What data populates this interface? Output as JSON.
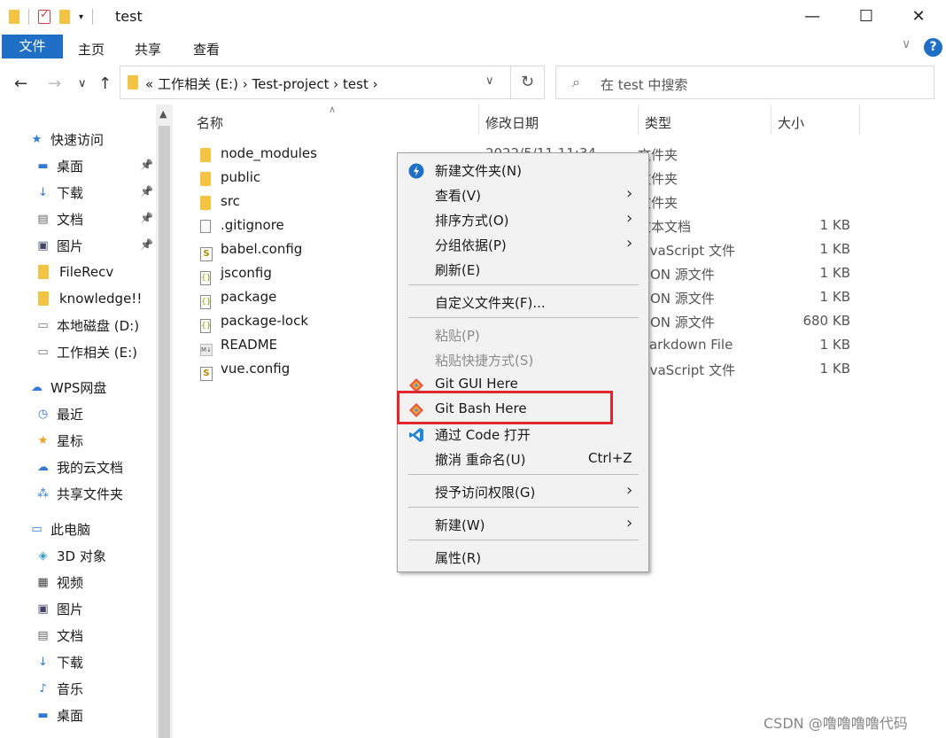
{
  "window": {
    "title": "test",
    "minimize": "—",
    "maximize": "☐",
    "close": "✕"
  },
  "ribbon": {
    "tabs": [
      "文件",
      "主页",
      "共享",
      "查看"
    ],
    "collapse": "∨",
    "help": "?"
  },
  "address": {
    "back": "←",
    "forward": "→",
    "recent": "∨",
    "up": "↑",
    "breadcrumb": "«  工作相关 (E:)  ›  Test-project  ›  test  ›",
    "dropdown": "∨",
    "refresh": "↻",
    "search_placeholder": "在 test 中搜索"
  },
  "sidebar": {
    "items": [
      {
        "label": "快速访问",
        "icon": "star-icon",
        "pinned": false
      },
      {
        "label": "桌面",
        "icon": "desktop-icon",
        "pinned": true
      },
      {
        "label": "下载",
        "icon": "download-icon",
        "pinned": true
      },
      {
        "label": "文档",
        "icon": "document-icon",
        "pinned": true
      },
      {
        "label": "图片",
        "icon": "picture-icon",
        "pinned": true
      },
      {
        "label": "FileRecv",
        "icon": "folder-icon",
        "pinned": false
      },
      {
        "label": "knowledge!!",
        "icon": "folder-icon",
        "pinned": false
      },
      {
        "label": "本地磁盘 (D:)",
        "icon": "drive-icon",
        "pinned": false
      },
      {
        "label": "工作相关 (E:)",
        "icon": "drive-icon",
        "pinned": false
      },
      {
        "label": "WPS网盘",
        "icon": "cloud-icon",
        "pinned": false
      },
      {
        "label": "最近",
        "icon": "clock-icon",
        "pinned": false
      },
      {
        "label": "星标",
        "icon": "star-icon",
        "pinned": false
      },
      {
        "label": "我的云文档",
        "icon": "cloud-icon",
        "pinned": false
      },
      {
        "label": "共享文件夹",
        "icon": "share-icon",
        "pinned": false
      },
      {
        "label": "此电脑",
        "icon": "computer-icon",
        "pinned": false
      },
      {
        "label": "3D 对象",
        "icon": "cube-icon",
        "pinned": false
      },
      {
        "label": "视频",
        "icon": "video-icon",
        "pinned": false
      },
      {
        "label": "图片",
        "icon": "picture-icon",
        "pinned": false
      },
      {
        "label": "文档",
        "icon": "document-icon",
        "pinned": false
      },
      {
        "label": "下载",
        "icon": "download-icon",
        "pinned": false
      },
      {
        "label": "音乐",
        "icon": "music-icon",
        "pinned": false
      },
      {
        "label": "桌面",
        "icon": "desktop-icon",
        "pinned": false
      }
    ]
  },
  "columns": {
    "name": "名称",
    "modified": "修改日期",
    "type": "类型",
    "size": "大小"
  },
  "files": [
    {
      "name": "node_modules",
      "modified": "2022/5/11 11:34",
      "type": "文件夹",
      "size": "",
      "icon": "folder-icon"
    },
    {
      "name": "public",
      "modified": "",
      "type": "文件夹",
      "size": "",
      "icon": "folder-icon"
    },
    {
      "name": "src",
      "modified": "",
      "type": "文件夹",
      "size": "",
      "icon": "folder-icon"
    },
    {
      "name": ".gitignore",
      "modified": "",
      "type": "文本文档",
      "size": "1 KB",
      "icon": "text-file-icon"
    },
    {
      "name": "babel.config",
      "modified": "",
      "type": "JavaScript 文件",
      "size": "1 KB",
      "icon": "js-file-icon"
    },
    {
      "name": "jsconfig",
      "modified": "",
      "type": "JSON 源文件",
      "size": "1 KB",
      "icon": "json-file-icon"
    },
    {
      "name": "package",
      "modified": "",
      "type": "JSON 源文件",
      "size": "1 KB",
      "icon": "json-file-icon"
    },
    {
      "name": "package-lock",
      "modified": "",
      "type": "JSON 源文件",
      "size": "680 KB",
      "icon": "json-file-icon"
    },
    {
      "name": "README",
      "modified": "",
      "type": "Markdown File",
      "size": "1 KB",
      "icon": "markdown-file-icon"
    },
    {
      "name": "vue.config",
      "modified": "",
      "type": "JavaScript 文件",
      "size": "1 KB",
      "icon": "js-file-icon"
    }
  ],
  "context_menu": {
    "new_folder": "新建文件夹(N)",
    "view": "查看(V)",
    "sort_by": "排序方式(O)",
    "group_by": "分组依据(P)",
    "refresh": "刷新(E)",
    "customize": "自定义文件夹(F)...",
    "paste": "粘贴(P)",
    "paste_shortcut": "粘贴快捷方式(S)",
    "git_gui": "Git GUI Here",
    "git_bash": "Git Bash Here",
    "open_with_code": "通过 Code 打开",
    "undo_rename": "撤消 重命名(U)",
    "undo_shortcut": "Ctrl+Z",
    "give_access": "授予访问权限(G)",
    "new": "新建(W)",
    "properties": "属性(R)"
  },
  "watermark": "CSDN @噜噜噜噜代码",
  "colors": {
    "accent": "#1f6fc7",
    "highlight_box": "#e0262f",
    "folder": "#f3c443"
  }
}
